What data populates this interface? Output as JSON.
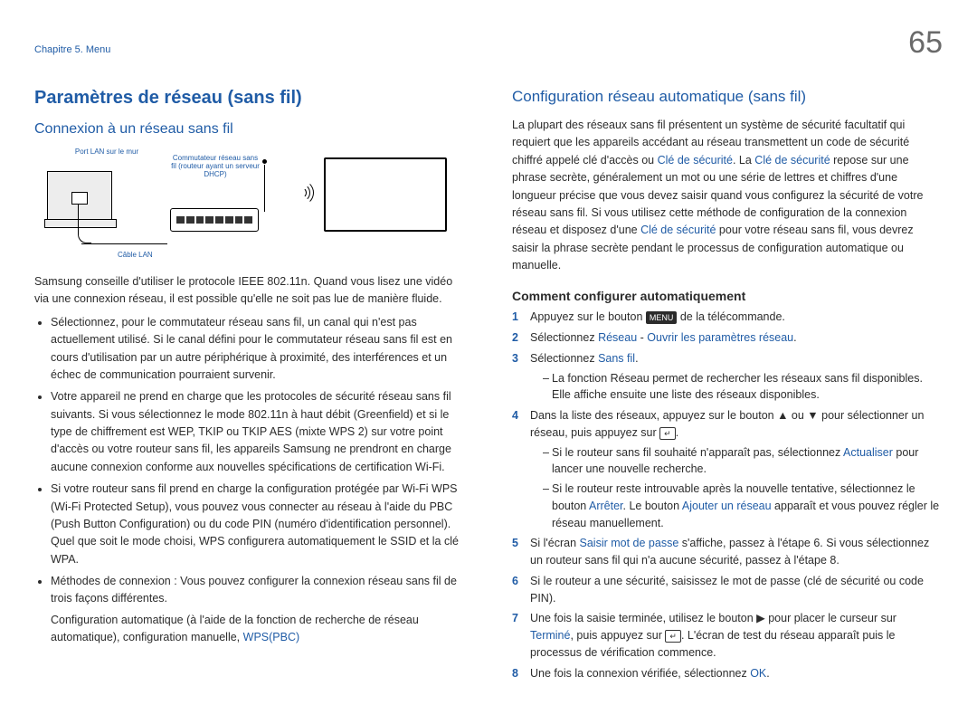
{
  "header": {
    "chapter": "Chapitre 5. Menu",
    "pageNumber": "65"
  },
  "left": {
    "title": "Paramètres de réseau (sans fil)",
    "sub1": "Connexion à un réseau sans fil",
    "diagramLabels": {
      "wall": "Port LAN sur le mur",
      "cable": "Câble LAN",
      "router": "Commutateur réseau sans fil (routeur ayant un serveur DHCP)"
    },
    "intro": "Samsung conseille d'utiliser le protocole IEEE 802.11n. Quand vous lisez une vidéo via une connexion réseau, il est possible qu'elle ne soit pas lue de manière fluide.",
    "bullets": [
      "Sélectionnez, pour le commutateur réseau sans fil, un canal qui n'est pas actuellement utilisé. Si le canal défini pour le commutateur réseau sans fil est en cours d'utilisation par un autre périphérique à proximité, des interférences et un échec de communication pourraient survenir.",
      "Votre appareil ne prend en charge que les protocoles de sécurité réseau sans fil suivants. Si vous sélectionnez le mode 802.11n à haut débit (Greenfield) et si le type de chiffrement est WEP, TKIP ou TKIP AES (mixte WPS 2) sur votre point d'accès ou votre routeur sans fil, les appareils Samsung ne prendront en charge aucune connexion conforme aux nouvelles spécifications de certification Wi-Fi.",
      "Si votre routeur sans fil prend en charge la configuration protégée par Wi-Fi WPS (Wi-Fi Protected Setup), vous pouvez vous connecter au réseau à l'aide du PBC (Push Button Configuration) ou du code PIN (numéro d'identification personnel). Quel que soit le mode choisi, WPS configurera automatiquement le SSID et la clé WPA.",
      "Méthodes de connexion : Vous pouvez configurer la connexion réseau sans fil de trois façons différentes."
    ],
    "bullet4Tail": {
      "pre": "Configuration automatique (à l'aide de la fonction de recherche de réseau automatique), configuration manuelle, ",
      "wps": "WPS(PBC)"
    }
  },
  "right": {
    "title": "Configuration réseau automatique (sans fil)",
    "p1": {
      "t1": "La plupart des réseaux sans fil présentent un système de sécurité facultatif qui requiert que les appareils accédant au réseau transmettent un code de sécurité chiffré appelé clé d'accès ou ",
      "hl1": "Clé de sécurité",
      "t2": ". La ",
      "hl2": "Clé de sécurité",
      "t3": " repose sur une phrase secrète, généralement un mot ou une série de lettres et chiffres d'une longueur précise que vous devez saisir quand vous configurez la sécurité de votre réseau sans fil. Si vous utilisez cette méthode de configuration de la connexion réseau et disposez d'une ",
      "hl3": "Clé de sécurité",
      "t4": " pour votre réseau sans fil, vous devrez saisir la phrase secrète pendant le processus de configuration automatique ou manuelle."
    },
    "sub2": "Comment configurer automatiquement",
    "step1": {
      "pre": "Appuyez sur le bouton ",
      "menu": "MENU",
      "post": " de la télécommande."
    },
    "step2": {
      "pre": "Sélectionnez ",
      "a": "Réseau",
      "mid": " - ",
      "b": "Ouvrir les paramètres réseau",
      "post": "."
    },
    "step3": {
      "pre": "Sélectionnez ",
      "a": "Sans fil",
      "post": "."
    },
    "step3sub": "La fonction Réseau permet de rechercher les réseaux sans fil disponibles. Elle affiche ensuite une liste des réseaux disponibles.",
    "step4": {
      "pre": "Dans la liste des réseaux, appuyez sur le bouton ▲ ou ▼ pour sélectionner un réseau, puis appuyez sur ",
      "enter": "↵",
      "post": "."
    },
    "step4sub1": {
      "pre": "Si le routeur sans fil souhaité n'apparaît pas, sélectionnez ",
      "a": "Actualiser",
      "post": " pour lancer une nouvelle recherche."
    },
    "step4sub2": {
      "pre": "Si le routeur reste introuvable après la nouvelle tentative, sélectionnez le bouton ",
      "a": "Arrêter",
      "post": ". Le bouton ",
      "b": "Ajouter un réseau",
      "post2": " apparaît et vous pouvez régler le réseau manuellement."
    },
    "step5": {
      "pre": "Si l'écran ",
      "a": "Saisir mot de passe",
      "post": " s'affiche, passez à l'étape 6. Si vous sélectionnez un routeur sans fil qui n'a aucune sécurité, passez à l'étape 8."
    },
    "step6": "Si le routeur a une sécurité, saisissez le mot de passe (clé de sécurité ou code PIN).",
    "step7": {
      "pre": "Une fois la saisie terminée, utilisez le bouton ▶ pour placer le curseur sur ",
      "a": "Terminé",
      "mid": ", puis appuyez sur ",
      "enter": "↵",
      "post": ". L'écran de test du réseau apparaît puis le processus de vérification commence."
    },
    "step8": {
      "pre": "Une fois la connexion vérifiée, sélectionnez ",
      "a": "OK",
      "post": "."
    }
  }
}
